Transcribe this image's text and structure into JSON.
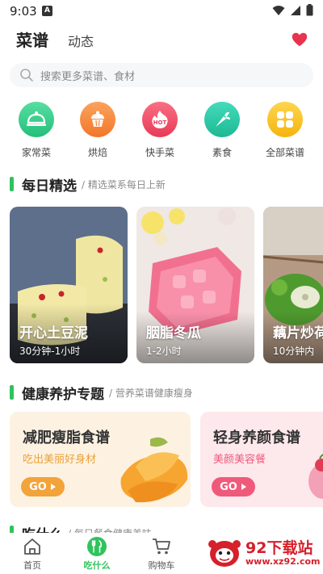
{
  "status_bar": {
    "time": "9:03",
    "notification_badge": "A"
  },
  "header": {
    "tab_main": "菜谱",
    "tab_secondary": "动态",
    "favorite_icon": "heart-icon"
  },
  "search": {
    "placeholder": "搜索更多菜谱、食材"
  },
  "categories": [
    {
      "label": "家常菜",
      "icon": "dish-cover-icon",
      "color": "#3ccf8e"
    },
    {
      "label": "烘焙",
      "icon": "cupcake-icon",
      "color": "#f68f3c"
    },
    {
      "label": "快手菜",
      "icon": "hot-flame-icon",
      "color": "#f0536a"
    },
    {
      "label": "素食",
      "icon": "carrot-icon",
      "color": "#29c7a5"
    },
    {
      "label": "全部菜谱",
      "icon": "grid-icon",
      "color": "#f8c529"
    }
  ],
  "daily": {
    "title": "每日精选",
    "subtitle": "/ 精选菜系每日上新",
    "items": [
      {
        "name": "开心土豆泥",
        "time": "30分钟-1小时"
      },
      {
        "name": "胭脂冬瓜",
        "time": "1-2小时"
      },
      {
        "name": "藕片炒荷",
        "time": "10分钟内"
      }
    ]
  },
  "health": {
    "title": "健康养护专题",
    "subtitle": "/ 营养菜谱健康瘦身",
    "cards": [
      {
        "title": "减肥瘦脂食谱",
        "subtitle": "吃出美丽好身材",
        "button": "GO",
        "accent": "#f2a33a"
      },
      {
        "title": "轻身养颜食谱",
        "subtitle": "美颜美容餐",
        "button": "GO",
        "accent": "#ef5a7a"
      }
    ]
  },
  "next_section": {
    "title": "吃什么",
    "subtitle": "/ 每日餐食健康美味"
  },
  "bottom_nav": [
    {
      "label": "首页",
      "icon": "home-icon",
      "active": false
    },
    {
      "label": "吃什么",
      "icon": "fork-knife-icon",
      "active": true
    },
    {
      "label": "购物车",
      "icon": "cart-icon",
      "active": false
    }
  ],
  "watermark": {
    "title": "92下载站",
    "url": "www.xz92.com"
  },
  "colors": {
    "accent_green": "#2fc35c",
    "active_nav": "#2fc35c",
    "inactive_nav": "#555555"
  }
}
